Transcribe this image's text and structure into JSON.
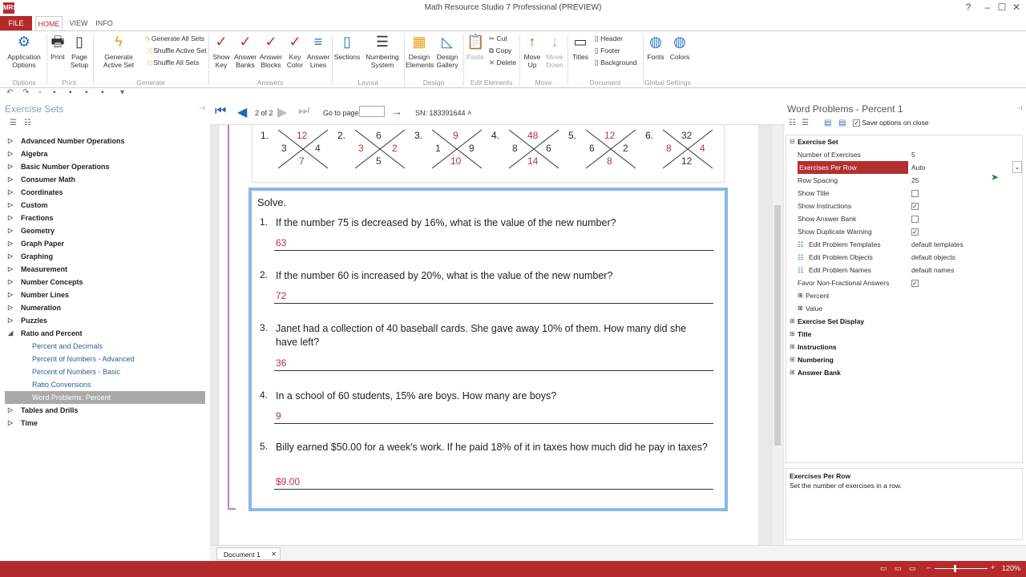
{
  "window": {
    "title": "Math Resource Studio 7 Professional (PREVIEW)",
    "app_icon": "MRS",
    "controls": [
      "?",
      "–",
      "☐",
      "✕"
    ]
  },
  "tabs": {
    "file": "FILE",
    "home": "HOME",
    "view": "VIEW",
    "info": "INFO"
  },
  "ribbon": {
    "app_options": "Application Options",
    "print": "Print",
    "page_setup": "Page Setup",
    "generate_active_set": "Generate Active Set",
    "generate_all_sets": "Generate All Sets",
    "shuffle_active_set": "Shuffle Active Set",
    "shuffle_all_sets": "Shuffle All Sets",
    "show_key": "Show Key",
    "answer_banks": "Answer Banks",
    "answer_blocks": "Answer Blocks",
    "key_color": "Key Color",
    "answer_lines": "Answer Lines",
    "sections": "Sections",
    "numbering_system": "Numbering System",
    "design_elements": "Design Elements",
    "design_gallery": "Design Gallery",
    "paste": "Paste",
    "cut": "Cut",
    "copy": "Copy",
    "delete": "Delete",
    "move_up": "Move Up",
    "move_down": "Move Down",
    "titles": "Titles",
    "header": "Header",
    "footer": "Footer",
    "background": "Background",
    "fonts": "Fonts",
    "colors": "Colors",
    "groups": {
      "options": "Options",
      "print": "Print",
      "generate": "Generate",
      "answers": "Answers",
      "layout": "Layout",
      "design": "Design",
      "edit_elements": "Edit Elements",
      "move": "Move",
      "document": "Document",
      "global_settings": "Global Settings"
    }
  },
  "left_panel": {
    "title": "Exercise Sets",
    "categories": [
      "Advanced Number Operations",
      "Algebra",
      "Basic Number Operations",
      "Consumer Math",
      "Coordinates",
      "Custom",
      "Fractions",
      "Geometry",
      "Graph Paper",
      "Graphing",
      "Measurement",
      "Number Concepts",
      "Number Lines",
      "Numeration",
      "Puzzles",
      "Ratio and Percent"
    ],
    "ratio_children": [
      "Percent and Decimals",
      "Percent of Numbers - Advanced",
      "Percent of Numbers - Basic",
      "Ratio Conversions",
      "Word Problems: Percent"
    ],
    "after": [
      "Tables and Drills",
      "Time"
    ]
  },
  "nav": {
    "page": "2 of 2",
    "goto_label": "Go to page:",
    "sn": "SN: 183391644"
  },
  "x_puzzles": [
    {
      "n": "1.",
      "top": "12",
      "left": "3",
      "right": "4",
      "bottom": "7",
      "top_red": true,
      "bottom_red": true
    },
    {
      "n": "2.",
      "top": "6",
      "left": "3",
      "right": "2",
      "bottom": "5",
      "left_red": true,
      "right_red": true
    },
    {
      "n": "3.",
      "top": "9",
      "left": "1",
      "right": "9",
      "bottom": "10",
      "top_red": true,
      "bottom_red": true
    },
    {
      "n": "4.",
      "top": "48",
      "left": "8",
      "right": "6",
      "bottom": "14",
      "top_red": true,
      "bottom_red": true
    },
    {
      "n": "5.",
      "top": "12",
      "left": "6",
      "right": "2",
      "bottom": "8",
      "top_red": true,
      "bottom_red": true
    },
    {
      "n": "6.",
      "top": "32",
      "left": "8",
      "right": "4",
      "bottom": "12",
      "left_red": true,
      "right_red": true
    }
  ],
  "solve": {
    "title": "Solve.",
    "questions": [
      {
        "n": "1.",
        "text": "If the number 75 is decreased by 16%, what is the value of the new number?",
        "answer": "63"
      },
      {
        "n": "2.",
        "text": "If the number 60 is increased by 20%, what is the value of the new number?",
        "answer": "72"
      },
      {
        "n": "3.",
        "text": "Janet had a collection of 40 baseball cards. She gave away 10% of them. How many did she have left?",
        "answer": "36"
      },
      {
        "n": "4.",
        "text": "In a school of 60 students, 15% are boys. How many are boys?",
        "answer": "9"
      },
      {
        "n": "5.",
        "text": "Billy earned $50.00 for a week's work. If he paid 18% of it in taxes how much did he pay in taxes?",
        "answer": "$9.00"
      }
    ]
  },
  "right_panel": {
    "title": "Word Problems - Percent 1",
    "save_opt": "Save options on close",
    "exercise_set": "Exercise Set",
    "props": [
      {
        "name": "Number of Exercises",
        "value": "5"
      },
      {
        "name": "Exercises Per Row",
        "value": "Auto"
      },
      {
        "name": "Row Spacing",
        "value": "25"
      },
      {
        "name": "Show Title",
        "value": ""
      },
      {
        "name": "Show Instructions",
        "value": "✓"
      },
      {
        "name": "Show Answer Bank",
        "value": ""
      },
      {
        "name": "Show Duplicate Warning",
        "value": "✓"
      },
      {
        "name": "Edit Problem Templates",
        "value": "default templates"
      },
      {
        "name": "Edit Problem Objects",
        "value": "default objects"
      },
      {
        "name": "Edit Problem Names",
        "value": "default names"
      },
      {
        "name": "Favor Non-Fractional Answers",
        "value": "✓"
      }
    ],
    "sub_percent": "Percent",
    "sub_value": "Value",
    "sections": [
      "Exercise Set Display",
      "Title",
      "Instructions",
      "Numbering",
      "Answer Bank"
    ],
    "desc_title": "Exercises Per Row",
    "desc_body": "Set the number of exercises in a row."
  },
  "doc_tab": "Document 1",
  "status": {
    "zoom": "120%"
  }
}
